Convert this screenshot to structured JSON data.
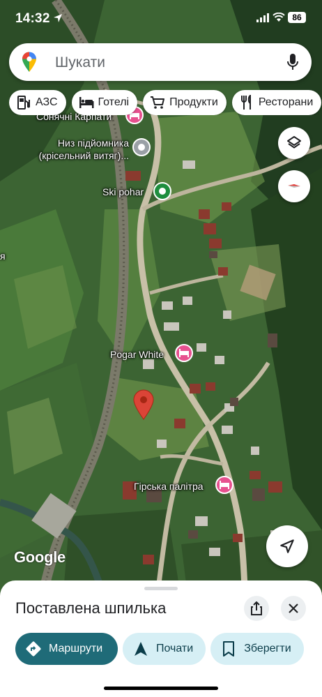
{
  "status_bar": {
    "time": "14:32",
    "battery": "86"
  },
  "search": {
    "placeholder": "Шукати"
  },
  "chips": [
    {
      "label": "АЗС",
      "icon": "gas-station-icon"
    },
    {
      "label": "Готелі",
      "icon": "bed-icon"
    },
    {
      "label": "Продукти",
      "icon": "shopping-cart-icon"
    },
    {
      "label": "Ресторани",
      "icon": "fork-knife-icon"
    }
  ],
  "map": {
    "places": {
      "hotel_top": "Сонячні Карпати",
      "lift_line1": "Низ підйомника",
      "lift_line2": "(крісельний витяг)...",
      "ski": "Ski pohar",
      "pogar": "Pogar White",
      "palitra": "Гірська палітра",
      "edge_letter": "я"
    },
    "attribution": "Google"
  },
  "sheet": {
    "title": "Поставлена шпилька",
    "actions": [
      {
        "label": "Маршрути",
        "icon": "directions-icon"
      },
      {
        "label": "Почати",
        "icon": "navigation-arrow-icon"
      },
      {
        "label": "Зберегти",
        "icon": "bookmark-icon"
      }
    ]
  },
  "colors": {
    "accent": "#1f6b78",
    "pin": "#db4437",
    "hotel": "#e7518f",
    "green_poi": "#1e8e3e"
  }
}
